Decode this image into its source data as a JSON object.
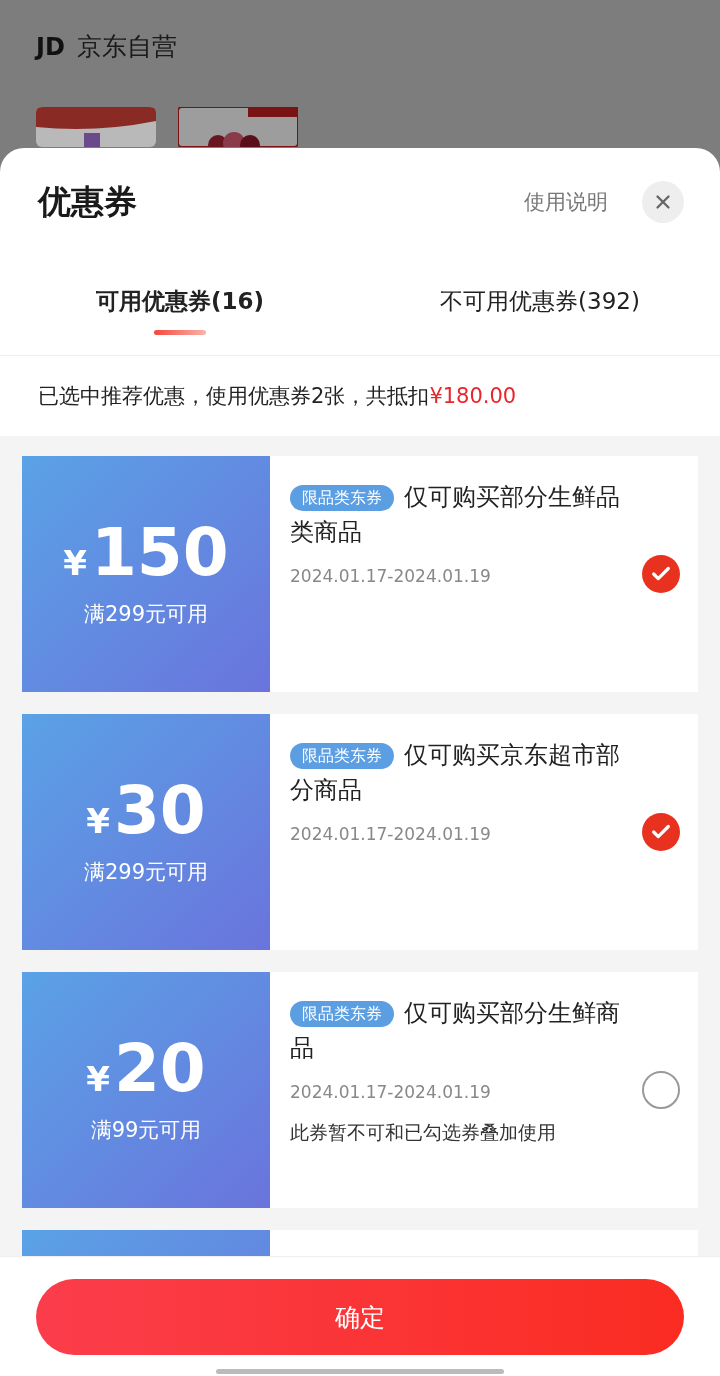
{
  "store": {
    "logo": "JD",
    "name": "京东自营"
  },
  "sheet": {
    "title": "优惠券",
    "help_link": "使用说明"
  },
  "tabs": [
    {
      "label": "可用优惠券(16)",
      "selected": true
    },
    {
      "label": "不可用优惠券(392)",
      "selected": false
    }
  ],
  "summary": {
    "text": "已选中推荐优惠，使用优惠券2张，共抵扣",
    "amount": "¥180.00"
  },
  "coupons": [
    {
      "currency": "¥",
      "amount": "150",
      "condition": "满299元可用",
      "tag": "限品类东券",
      "title": "仅可购买部分生鲜品类商品",
      "date": "2024.01.17-2024.01.19",
      "selected": true
    },
    {
      "currency": "¥",
      "amount": "30",
      "condition": "满299元可用",
      "tag": "限品类东券",
      "title": "仅可购买京东超市部分商品",
      "date": "2024.01.17-2024.01.19",
      "selected": true
    },
    {
      "currency": "¥",
      "amount": "20",
      "condition": "满99元可用",
      "tag": "限品类东券",
      "title": "仅可购买部分生鲜商品",
      "date": "2024.01.17-2024.01.19",
      "note": "此券暂不可和已勾选券叠加使用",
      "selected": false
    }
  ],
  "confirm_button": "确定"
}
